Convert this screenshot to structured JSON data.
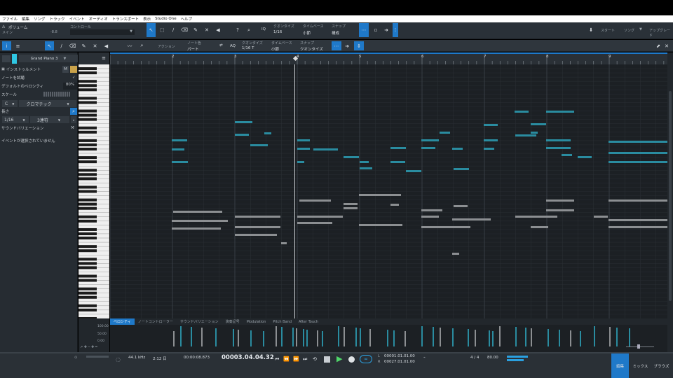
{
  "menu": [
    "ファイル",
    "編集",
    "ソング",
    "トラック",
    "イベント",
    "オーディオ",
    "トランスポート",
    "表示",
    "Studio One",
    "ヘルプ"
  ],
  "toolbar": {
    "volume_label": "ボリューム",
    "main_label": "メイン",
    "volume_value": "-8.8",
    "control_label": "コントロール",
    "quantize_label": "クオンタイズ",
    "quantize_value": "1/16",
    "timebase_label": "タイムベース",
    "timebase_value": "小節",
    "snap_label": "スナップ",
    "snap_value": "構成",
    "iq_label": "IQ",
    "start_label": "スタート",
    "song_label": "ソング",
    "upgrade_label": "アップグレード"
  },
  "edit_toolbar": {
    "action_label": "アクション",
    "note_color_label": "ノート色",
    "note_color_value": "パート",
    "aq_label": "AQ",
    "quantize_label": "クオンタイズ",
    "quantize_value": "1/16 T",
    "timebase_label": "タイムベース",
    "timebase_value": "小節",
    "snap_label": "スナップ",
    "snap_value": "クオンタイズ"
  },
  "inspector": {
    "instrument_name": "Grand Piano 3",
    "instrument_label": "インストゥルメント",
    "m_label": "M",
    "preview_notes_label": "ノートを試聴",
    "default_velocity_label": "デフォルトのベロシティ",
    "default_velocity_value": "80%",
    "scale_label": "スケール",
    "scale_root": "C",
    "scale_type": "クロマチック",
    "length_label": "長さ",
    "length_value": "1/16",
    "length_mode": "3連符",
    "sound_variation_label": "サウンドバリエーション",
    "no_event_text": "イベントが選択されていません"
  },
  "ruler_marks": [
    "2",
    "3",
    "4",
    "5",
    "6",
    "7",
    "8",
    "9"
  ],
  "lane_tabs": [
    "ベロシティ",
    "ノートコントローラー",
    "サウンドバリエーション",
    "演奏記号",
    "Modulation",
    "Pitch Band",
    "After Touch"
  ],
  "velocity_scale": [
    "100.00",
    "50.00",
    "0.00"
  ],
  "transport": {
    "sample_rate": "44.1 kHz",
    "record_time": "2:12 日",
    "time_display": "00:00:08.873",
    "bars_display": "00003.04.04.32",
    "loop_start": "00001.01.01.00",
    "loop_end": "00027.01.01.00",
    "time_signature": "4 / 4",
    "tempo": "80.00",
    "edit_tab": "編集",
    "mix_tab": "ミックス",
    "browse_tab": "ブラウズ",
    "l_label": "L",
    "r_label": "R"
  },
  "colors": {
    "accent": "#1f79c9",
    "teal_note": "#2a8ca0",
    "gray_note": "#8c8f92"
  }
}
